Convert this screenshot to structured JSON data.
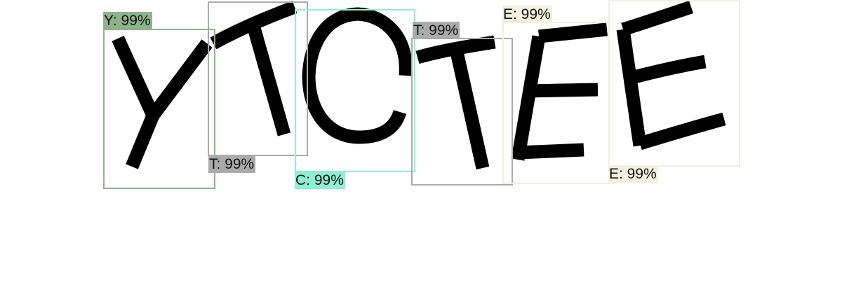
{
  "detections": [
    {
      "label": "Y: 99%",
      "color": "#8db48b"
    },
    {
      "label": "T: 99%",
      "color": "#ababab"
    },
    {
      "label": "C: 99%",
      "color": "#8ef0d3"
    },
    {
      "label": "T: 99%",
      "color": "#ababab"
    },
    {
      "label": "E: 99%",
      "color": "#f1f1dd"
    },
    {
      "label": "E: 99%",
      "color": "#f1f1dd"
    }
  ]
}
